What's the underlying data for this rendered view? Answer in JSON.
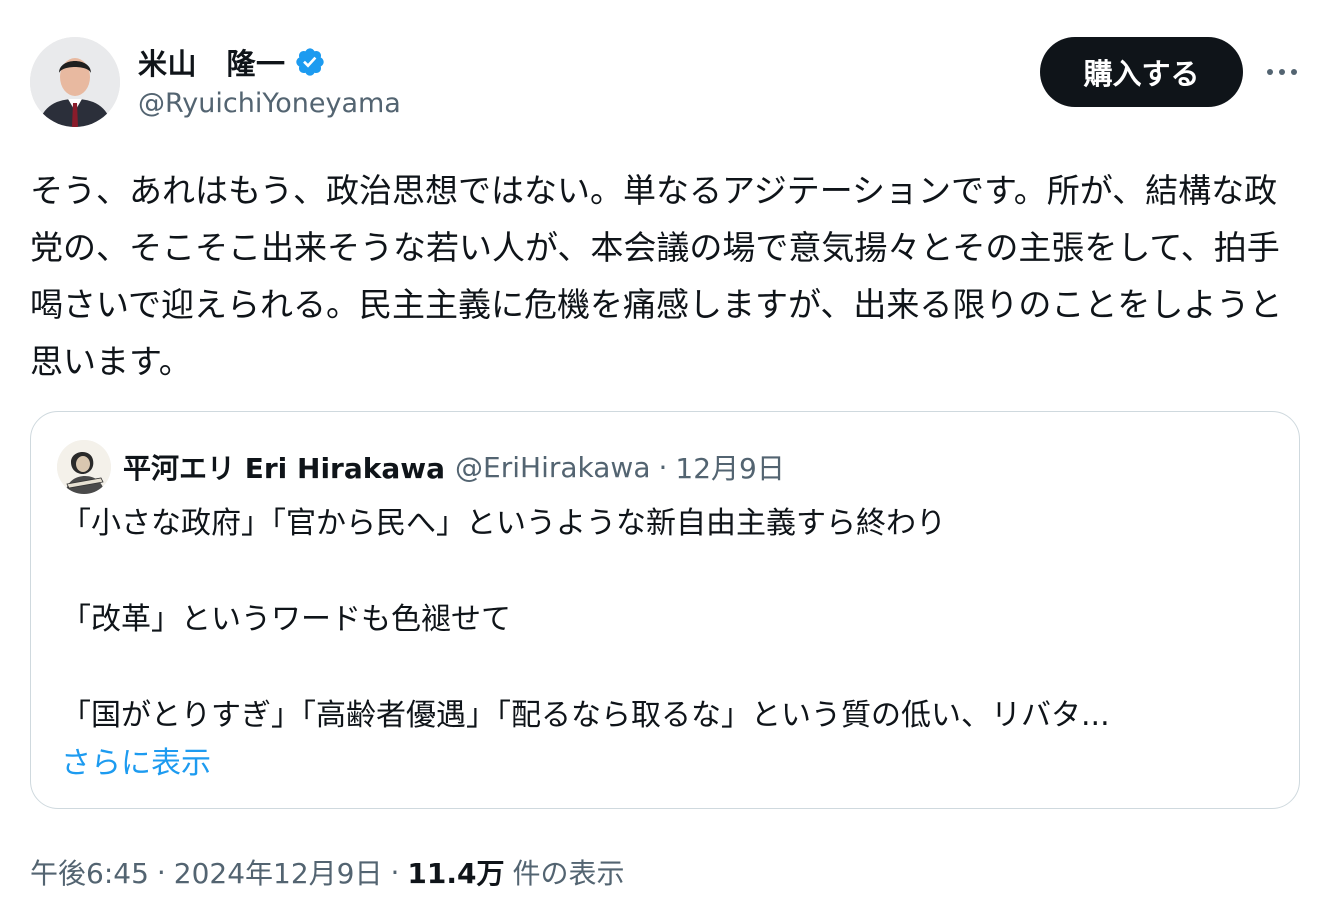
{
  "author": {
    "name": "米山　隆一",
    "handle": "@RyuichiYoneyama",
    "verified": true
  },
  "actions": {
    "buy_label": "購入する",
    "more_icon": "more-horizontal-icon"
  },
  "tweet": {
    "text": "そう、あれはもう、政治思想ではない。単なるアジテーションです。所が、結構な政党の、そこそこ出来そうな若い人が、本会議の場で意気揚々とその主張をして、拍手喝さいで迎えられる。民主主義に危機を痛感しますが、出来る限りのことをしようと思います。"
  },
  "quote": {
    "name": "平河エリ Eri Hirakawa",
    "handle": "@EriHirakawa",
    "separator": "·",
    "date": "12月9日",
    "lines": [
      "「小さな政府」「官から民へ」というような新自由主義すら終わり",
      "「改革」というワードも色褪せて",
      "「国がとりすぎ」「高齢者優遇」「配るなら取るな」という質の低い、リバタ..."
    ],
    "show_more": "さらに表示"
  },
  "meta": {
    "time": "午後6:45",
    "separator": "·",
    "date": "2024年12月9日",
    "views_count": "11.4万",
    "views_label": "件の表示"
  },
  "colors": {
    "text": "#0f1419",
    "secondary": "#536471",
    "link": "#1d9bf0",
    "border": "#cfd9de",
    "verified": "#1d9bf0",
    "button_bg": "#0f1419"
  }
}
